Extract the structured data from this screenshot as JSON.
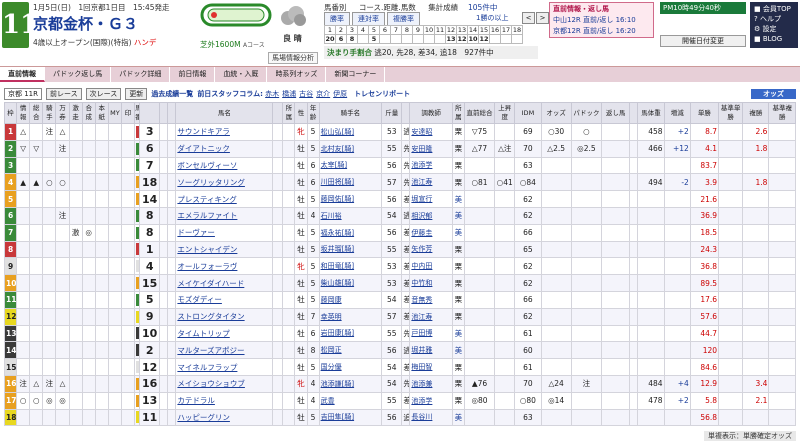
{
  "header": {
    "race_no": "11",
    "info": "1月5日(日)　1回京都1日目　15:45発走",
    "race_name": "京都金杯・Ｇ３",
    "cond_pre": "4歳以上オープン(国際)(特指)",
    "cond_hande": "ハンデ",
    "course": "芝外1600M",
    "course_sub": "Aコース",
    "ground": "良 晴"
  },
  "menu": {
    "links": [
      "馬番別",
      "コース.距離.馬数",
      "集計成績"
    ],
    "tabs": [
      "勝率",
      "連対率",
      "複勝率"
    ],
    "count": "105件中",
    "pager": "1勝の以上",
    "prev": "<",
    "next": ">"
  },
  "grid": {
    "r1": [
      "1",
      "2",
      "3",
      "4",
      "5",
      "6",
      "7",
      "8",
      "9",
      "10",
      "11",
      "12",
      "13",
      "14",
      "15",
      "16",
      "17",
      "18"
    ],
    "r2": [
      "20",
      "6",
      "8",
      "",
      "5",
      "",
      "",
      "",
      "",
      "",
      "",
      "13",
      "12",
      "10",
      "12",
      "",
      "",
      ""
    ]
  },
  "decided": {
    "label": "決まり手割合",
    "text": "逃20, 先28, 差34, 追18　927件中"
  },
  "next": {
    "title": "直前情報・返し馬",
    "lines": [
      "中山12R 直前/返し 16:10",
      "京都12R 直前/返し 16:20"
    ],
    "side": "近レース"
  },
  "pm": {
    "text": "PM10時49分40秒",
    "date_change": "開催日付変更"
  },
  "side_menu": [
    "■ 会員TOP",
    "? ヘルプ",
    "⚙ 設定",
    "■ BLOG"
  ],
  "paddock_tag": "馬場情報分析",
  "tabs": [
    "直前情報",
    "パドック返し馬",
    "パドック詳細",
    "前日情報",
    "血統・入厩",
    "時系列オッズ",
    "新聞コーナー"
  ],
  "toolbar": {
    "race_sel": "京都 11R",
    "prev": "前レース",
    "next": "次レース",
    "update": "更新",
    "past": "過去成績一覧",
    "staff_label": "前日スタッフコラム:",
    "staff": [
      "赤木",
      "橋浦",
      "古谷",
      "京介",
      "伊原"
    ],
    "training": "トレセンリポート",
    "odds": "オッズ"
  },
  "columns": [
    "枠",
    "情報",
    "総合",
    "騎手",
    "万券",
    "激走",
    "合成",
    "本紙",
    "MY",
    "印",
    "馬番",
    "",
    "",
    "",
    "馬名",
    "",
    "所属",
    "性",
    "年齢",
    "騎手名",
    "斤量",
    "",
    "調教師",
    "所属",
    "直前総合",
    "上昇度",
    "IDM",
    "オッズ",
    "パドック",
    "返し馬",
    "",
    "馬体重",
    "増減",
    "単勝",
    "基準単勝",
    "複勝",
    "基準複勝"
  ],
  "rows": [
    {
      "w": "1",
      "wc": "#c8383a",
      "m": [
        "△",
        "",
        "注",
        "△",
        "",
        "",
        "",
        "",
        "",
        ""
      ],
      "no": "3",
      "name": "サウンドキアラ",
      "sex": "牝",
      "age": "5",
      "mark": "逃",
      "jk": "松山弘[騎]",
      "kin": "53",
      "tr": "安達昭",
      "aff": "栗",
      "dk": "▽75",
      "jo": "",
      "idm": "69",
      "od": "○30",
      "pd": "○",
      "kh": "",
      "bw": "458",
      "diff": "+2",
      "t": "8.7",
      "tb": "",
      "f": "2.6",
      "fb": ""
    },
    {
      "w": "2",
      "wc": "#3a8a3a",
      "m": [
        "▽",
        "▽",
        "",
        "注",
        "",
        "",
        "",
        "",
        "",
        ""
      ],
      "no": "6",
      "name": "ダイアトニック",
      "sex": "牡",
      "age": "5",
      "mark": "先",
      "jk": "北村友[騎]",
      "kin": "55",
      "tr": "安田隆",
      "aff": "栗",
      "dk": "△77",
      "jo": "△注",
      "idm": "70",
      "od": "△2.5",
      "pd": "◎2.5",
      "kh": "",
      "bw": "466",
      "diff": "+12",
      "t": "4.1",
      "tb": "",
      "f": "1.8",
      "fb": ""
    },
    {
      "w": "3",
      "wc": "#3a8a3a",
      "m": [
        "",
        "",
        "",
        "",
        "",
        "",
        "",
        "",
        "",
        ""
      ],
      "no": "7",
      "name": "ボンセルヴィーソ",
      "sex": "牡",
      "age": "6",
      "mark": "先",
      "jk": "太宰[騎]",
      "kin": "56",
      "tr": "池添学",
      "aff": "栗",
      "dk": "",
      "jo": "",
      "idm": "63",
      "od": "",
      "pd": "",
      "kh": "",
      "bw": "",
      "diff": "",
      "t": "83.7",
      "tb": "",
      "f": "",
      "fb": ""
    },
    {
      "w": "4",
      "wc": "#e8a020",
      "m": [
        "▲",
        "▲",
        "○",
        "○",
        "",
        "",
        "",
        "",
        "",
        ""
      ],
      "no": "18",
      "name": "ソーグリッタリング",
      "sex": "牡",
      "age": "6",
      "mark": "先",
      "jk": "川田将[騎]",
      "kin": "57",
      "tr": "池江寿",
      "aff": "栗",
      "dk": "○81",
      "jo": "○41",
      "idm": "○84",
      "od": "",
      "pd": "",
      "kh": "",
      "bw": "494",
      "diff": "-2",
      "t": "3.9",
      "tb": "",
      "f": "1.8",
      "fb": ""
    },
    {
      "w": "5",
      "wc": "#e8a020",
      "m": [
        "",
        "",
        "",
        "",
        "",
        "",
        "",
        "",
        "",
        ""
      ],
      "no": "14",
      "name": "プレスティキング",
      "sex": "牡",
      "age": "5",
      "mark": "差",
      "jk": "藤岡佑[騎]",
      "kin": "56",
      "tr": "堀宣行",
      "aff": "美",
      "dk": "",
      "jo": "",
      "idm": "62",
      "od": "",
      "pd": "",
      "kh": "",
      "bw": "",
      "diff": "",
      "t": "21.6",
      "tb": "",
      "f": "",
      "fb": ""
    },
    {
      "w": "6",
      "wc": "#3a8a3a",
      "m": [
        "",
        "",
        "",
        "注",
        "",
        "",
        "",
        "",
        "",
        ""
      ],
      "no": "8",
      "name": "エメラルファイト",
      "sex": "牡",
      "age": "4",
      "mark": "逃",
      "jk": "石川裕",
      "kin": "54",
      "tr": "相沢郁",
      "aff": "美",
      "dk": "",
      "jo": "",
      "idm": "62",
      "od": "",
      "pd": "",
      "kh": "",
      "bw": "",
      "diff": "",
      "t": "36.9",
      "tb": "",
      "f": "",
      "fb": ""
    },
    {
      "w": "7",
      "wc": "#3a8a3a",
      "m": [
        "",
        "",
        "",
        "",
        "激",
        "◎",
        "",
        "",
        "",
        ""
      ],
      "no": "8",
      "name": "ドーヴァー",
      "sex": "牡",
      "age": "5",
      "mark": "差",
      "jk": "福永祐[騎]",
      "kin": "56",
      "tr": "伊藤圭",
      "aff": "美",
      "dk": "",
      "jo": "",
      "idm": "66",
      "od": "",
      "pd": "",
      "kh": "",
      "bw": "",
      "diff": "",
      "t": "18.5",
      "tb": "",
      "f": "",
      "fb": ""
    },
    {
      "w": "8",
      "wc": "#c8383a",
      "m": [
        "",
        "",
        "",
        "",
        "",
        "",
        "",
        "",
        "",
        ""
      ],
      "no": "1",
      "name": "エントシャイデン",
      "sex": "牡",
      "age": "5",
      "mark": "差",
      "jk": "坂井瑠[騎]",
      "kin": "55",
      "tr": "矢作芳",
      "aff": "栗",
      "dk": "",
      "jo": "",
      "idm": "65",
      "od": "",
      "pd": "",
      "kh": "",
      "bw": "",
      "diff": "",
      "t": "24.3",
      "tb": "",
      "f": "",
      "fb": ""
    },
    {
      "w": "9",
      "wc": "#e0e0e0",
      "m": [
        "",
        "",
        "",
        "",
        "",
        "",
        "",
        "",
        "",
        ""
      ],
      "no": "4",
      "name": "オールフォーラヴ",
      "sex": "牝",
      "age": "5",
      "mark": "差",
      "jk": "和田竜[騎]",
      "kin": "53",
      "tr": "中内田",
      "aff": "栗",
      "dk": "",
      "jo": "",
      "idm": "62",
      "od": "",
      "pd": "",
      "kh": "",
      "bw": "",
      "diff": "",
      "t": "36.8",
      "tb": "",
      "f": "",
      "fb": ""
    },
    {
      "w": "10",
      "wc": "#e8a020",
      "m": [
        "",
        "",
        "",
        "",
        "",
        "",
        "",
        "",
        "",
        ""
      ],
      "no": "15",
      "name": "メイケイダイハード",
      "sex": "牡",
      "age": "5",
      "mark": "差",
      "jk": "柴山雄[騎]",
      "kin": "53",
      "tr": "中竹和",
      "aff": "栗",
      "dk": "",
      "jo": "",
      "idm": "62",
      "od": "",
      "pd": "",
      "kh": "",
      "bw": "",
      "diff": "",
      "t": "89.5",
      "tb": "",
      "f": "",
      "fb": ""
    },
    {
      "w": "11",
      "wc": "#3a8a3a",
      "m": [
        "",
        "",
        "",
        "",
        "",
        "",
        "",
        "",
        "",
        ""
      ],
      "no": "5",
      "name": "モズダディー",
      "sex": "牡",
      "age": "5",
      "mark": "差",
      "jk": "藤岡康",
      "kin": "54",
      "tr": "音無秀",
      "aff": "栗",
      "dk": "",
      "jo": "",
      "idm": "66",
      "od": "",
      "pd": "",
      "kh": "",
      "bw": "",
      "diff": "",
      "t": "17.6",
      "tb": "",
      "f": "",
      "fb": ""
    },
    {
      "w": "12",
      "wc": "#e8d820",
      "m": [
        "",
        "",
        "",
        "",
        "",
        "",
        "",
        "",
        "",
        ""
      ],
      "no": "9",
      "name": "ストロングタイタン",
      "sex": "牡",
      "age": "7",
      "mark": "差",
      "jk": "幸英明",
      "kin": "57",
      "tr": "池江寿",
      "aff": "栗",
      "dk": "",
      "jo": "",
      "idm": "62",
      "od": "",
      "pd": "",
      "kh": "",
      "bw": "",
      "diff": "",
      "t": "57.6",
      "tb": "",
      "f": "",
      "fb": ""
    },
    {
      "w": "13",
      "wc": "#3a3a3a",
      "m": [
        "",
        "",
        "",
        "",
        "",
        "",
        "",
        "",
        "",
        ""
      ],
      "no": "10",
      "name": "タイムトリップ",
      "sex": "牡",
      "age": "6",
      "mark": "先",
      "jk": "岩田康[騎]",
      "kin": "55",
      "tr": "戸田博",
      "aff": "美",
      "dk": "",
      "jo": "",
      "idm": "61",
      "od": "",
      "pd": "",
      "kh": "",
      "bw": "",
      "diff": "",
      "t": "44.7",
      "tb": "",
      "f": "",
      "fb": ""
    },
    {
      "w": "14",
      "wc": "#3a3a3a",
      "m": [
        "",
        "",
        "",
        "",
        "",
        "",
        "",
        "",
        "",
        ""
      ],
      "no": "2",
      "name": "マルターズアポジー",
      "sex": "牡",
      "age": "8",
      "mark": "逃",
      "jk": "松岡正",
      "kin": "56",
      "tr": "堀井雅",
      "aff": "美",
      "dk": "",
      "jo": "",
      "idm": "60",
      "od": "",
      "pd": "",
      "kh": "",
      "bw": "",
      "diff": "",
      "t": "120",
      "tb": "",
      "f": "",
      "fb": ""
    },
    {
      "w": "15",
      "wc": "#e0e0e0",
      "m": [
        "",
        "",
        "",
        "",
        "",
        "",
        "",
        "",
        "",
        ""
      ],
      "no": "12",
      "name": "マイネルフラップ",
      "sex": "牡",
      "age": "5",
      "mark": "差",
      "jk": "国分優",
      "kin": "54",
      "tr": "梅田智",
      "aff": "栗",
      "dk": "",
      "jo": "",
      "idm": "61",
      "od": "",
      "pd": "",
      "kh": "",
      "bw": "",
      "diff": "",
      "t": "84.6",
      "tb": "",
      "f": "",
      "fb": ""
    },
    {
      "w": "16",
      "wc": "#e8a020",
      "m": [
        "注",
        "△",
        "注",
        "△",
        "",
        "",
        "",
        "",
        "",
        ""
      ],
      "no": "16",
      "name": "メイショウショウブ",
      "sex": "牝",
      "age": "4",
      "mark": "先",
      "jk": "池添謙[騎]",
      "kin": "54",
      "tr": "池添兼",
      "aff": "栗",
      "dk": "▲76",
      "jo": "",
      "idm": "70",
      "od": "△24",
      "pd": "注",
      "kh": "",
      "bw": "484",
      "diff": "+4",
      "t": "12.9",
      "tb": "",
      "f": "3.4",
      "fb": ""
    },
    {
      "w": "17",
      "wc": "#e8a020",
      "m": [
        "○",
        "○",
        "◎",
        "◎",
        "",
        "",
        "",
        "",
        "",
        ""
      ],
      "no": "13",
      "name": "カテドラル",
      "sex": "牡",
      "age": "4",
      "mark": "差",
      "jk": "武豊",
      "kin": "55",
      "tr": "池添学",
      "aff": "栗",
      "dk": "◎80",
      "jo": "",
      "idm": "○80",
      "od": "◎14",
      "pd": "",
      "kh": "",
      "bw": "478",
      "diff": "+2",
      "t": "5.8",
      "tb": "",
      "f": "2.1",
      "fb": ""
    },
    {
      "w": "18",
      "wc": "#e8d820",
      "m": [
        "",
        "",
        "",
        "",
        "",
        "",
        "",
        "",
        "",
        ""
      ],
      "no": "11",
      "name": "ハッピーグリン",
      "sex": "牡",
      "age": "5",
      "mark": "追",
      "jk": "吉田隼[騎]",
      "kin": "56",
      "tr": "長谷川",
      "aff": "美",
      "dk": "",
      "jo": "",
      "idm": "63",
      "od": "",
      "pd": "",
      "kh": "",
      "bw": "",
      "diff": "",
      "t": "56.8",
      "tb": "",
      "f": "",
      "fb": ""
    }
  ],
  "footer": "単複表示：単勝確定オッズ"
}
